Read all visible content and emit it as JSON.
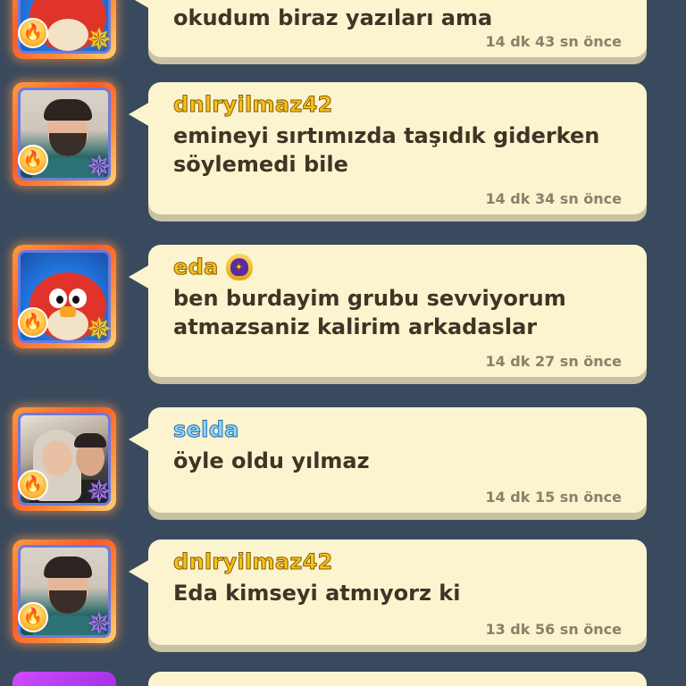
{
  "messages": [
    {
      "username": "",
      "text": "okudum biraz yazıları ama",
      "time": "14 dk 43 sn önce",
      "avatar": "bird-avatar",
      "rank_color": "gold"
    },
    {
      "username": "dnlryilmaz42",
      "text_lines": [
        "emineyi sırtımızda taşıdık giderken",
        "söylemedi bile"
      ],
      "time": "14 dk 34 sn önce",
      "avatar": "man-avatar",
      "rank_color": "violet"
    },
    {
      "username": "eda",
      "text_lines": [
        "ben burdayim grubu sevviyorum",
        "atmazsaniz kalirim arkadaslar"
      ],
      "time": "14 dk 27 sn önce",
      "avatar": "bird-avatar",
      "rank_color": "gold",
      "badge": "shield-badge-icon"
    },
    {
      "username": "selda",
      "text": "öyle oldu yılmaz",
      "time": "14 dk 15 sn önce",
      "avatar": "couple-avatar",
      "rank_color": "violet"
    },
    {
      "username": "dnlryilmaz42",
      "text": "Eda kimseyi atmıyorz ki",
      "time": "13 dk 56 sn önce",
      "avatar": "man-avatar",
      "rank_color": "violet"
    }
  ],
  "colors": {
    "background": "#3a4a5e",
    "bubble": "#fbf4cf",
    "username_gold": "#f6c21a",
    "username_blue": "#8ad8ff",
    "text": "#3f3526",
    "time": "#8a806a"
  }
}
